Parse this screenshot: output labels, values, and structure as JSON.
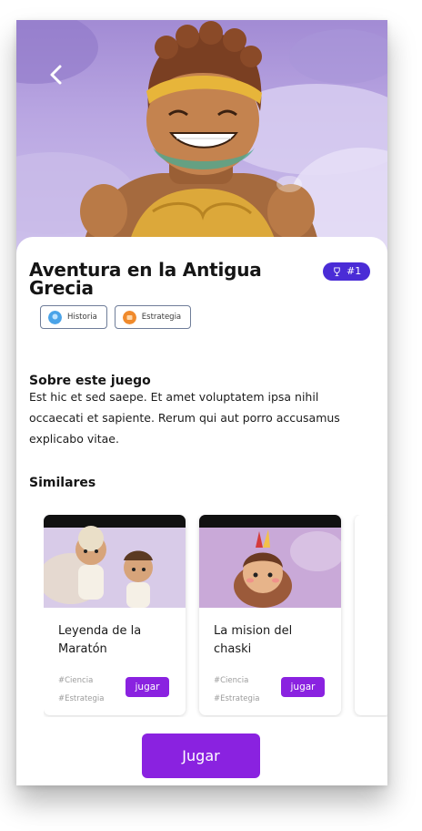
{
  "hero": {
    "back_icon": "chevron-left-icon"
  },
  "game": {
    "title": "Aventura en la Antigua Grecia",
    "rank_icon": "trophy-icon",
    "rank": "#1",
    "tags": [
      {
        "label": "Historia",
        "icon": "historia-icon",
        "color": "#4aa3e8"
      },
      {
        "label": "Estrategia",
        "icon": "estrategia-icon",
        "color": "#f08a2c"
      }
    ]
  },
  "about": {
    "heading": "Sobre este juego",
    "text": "Est hic et sed saepe. Et amet voluptatem ipsa nihil occaecati et sapiente. Rerum qui aut porro accusamus explicabo vitae."
  },
  "similar": {
    "heading": "Similares",
    "cards": [
      {
        "title": "Leyenda de la Maratón",
        "tags": [
          "#Ciencia",
          "#Estrategia"
        ],
        "button": "jugar"
      },
      {
        "title": "La mision del chaski",
        "tags": [
          "#Ciencia",
          "#Estrategia"
        ],
        "button": "jugar"
      }
    ]
  },
  "cta": {
    "label": "Jugar"
  },
  "colors": {
    "accent": "#8a22e0",
    "badge": "#4a2cd6"
  }
}
